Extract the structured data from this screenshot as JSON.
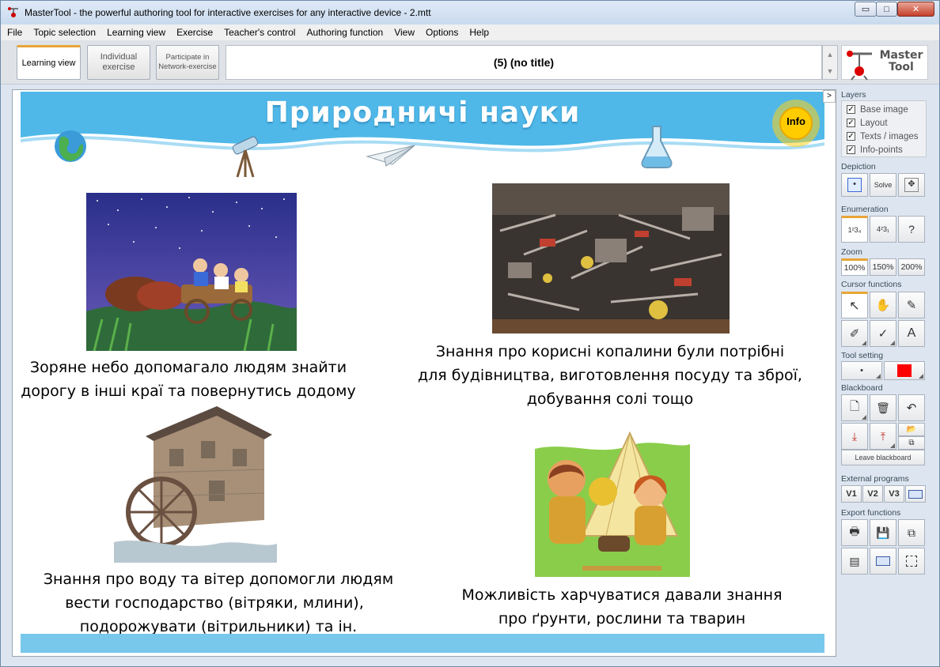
{
  "window": {
    "title": "MasterTool - the powerful authoring tool for interactive exercises for any interactive device - 2.mtt",
    "controls": {
      "minimize": "▭",
      "maximize": "□",
      "close": "✕"
    }
  },
  "menu": [
    "File",
    "Topic selection",
    "Learning view",
    "Exercise",
    "Teacher's control",
    "Authoring function",
    "View",
    "Options",
    "Help"
  ],
  "toolbar": {
    "learning_view": "Learning view",
    "individual_exercise": "Individual exercise",
    "network_exercise": "Participate in Network-exercise",
    "page_title": "(5) (no title)",
    "logo_line1": "Master",
    "logo_line2": "Tool"
  },
  "lesson": {
    "banner_title": "Природничі науки",
    "info_label": "Info",
    "captions": {
      "stars": [
        "Зоряне небо допомагало людям знайти",
        "дорогу в інші краї та повернутись додому"
      ],
      "minerals": [
        "Знання про корисні копалини були потрібні",
        "для будівництва, виготовлення посуду та зброї,",
        "добування солі тощо"
      ],
      "water_wind": [
        "Знання про воду та вітер допомогли людям",
        "вести господарство (вітряки, млини),",
        "подорожувати (вітрильники) та ін."
      ],
      "food": [
        "Можливість харчуватися давали знання",
        "про ґрунти, рослини та тварин"
      ]
    },
    "collapse_arrow": ">"
  },
  "right_panel": {
    "layers": {
      "title": "Layers",
      "items": [
        {
          "label": "Base image",
          "checked": true
        },
        {
          "label": "Layout",
          "checked": true
        },
        {
          "label": "Texts / images",
          "checked": true
        },
        {
          "label": "Info-points",
          "checked": true
        }
      ]
    },
    "depiction": {
      "title": "Depiction",
      "solve": "Solve"
    },
    "enumeration": {
      "title": "Enumeration",
      "help": "?"
    },
    "zoom": {
      "title": "Zoom",
      "levels": [
        "100%",
        "150%",
        "200%"
      ],
      "selected": "100%"
    },
    "cursor_functions": {
      "title": "Cursor functions",
      "text_tool": "A"
    },
    "tool_setting": {
      "title": "Tool setting",
      "color": "#ff0000"
    },
    "blackboard": {
      "title": "Blackboard",
      "leave": "Leave blackboard"
    },
    "external_programs": {
      "title": "External programs",
      "items": [
        "V1",
        "V2",
        "V3"
      ]
    },
    "export_functions": {
      "title": "Export functions"
    }
  },
  "colors": {
    "accent": "#e8a535",
    "banner_sky": "#4fb8e8",
    "bottom_strip": "#78c8ec"
  }
}
